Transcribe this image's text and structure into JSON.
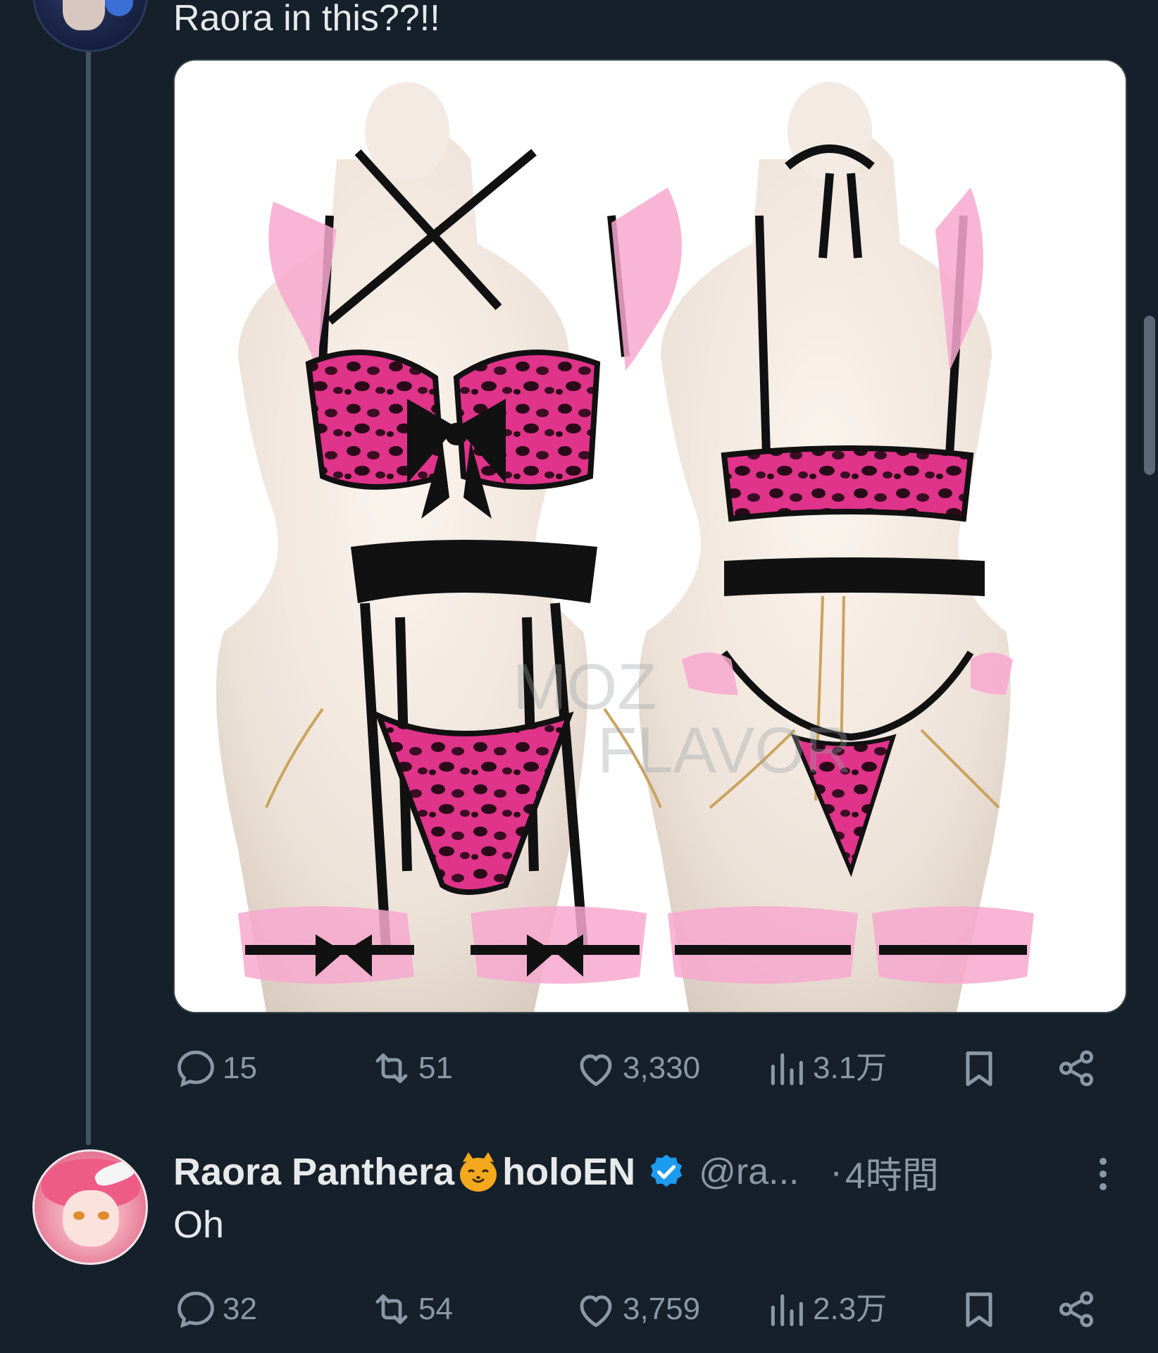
{
  "tweet1": {
    "text": "Raora in this??!!",
    "actions": {
      "replies": "15",
      "retweets": "51",
      "likes": "3,330",
      "views": "3.1万"
    }
  },
  "tweet2": {
    "display_name_part1": "Raora Panthera",
    "display_name_part2": "holoEN",
    "handle": "@ra...",
    "separator": "·",
    "time": "4時間",
    "text": "Oh",
    "actions": {
      "replies": "32",
      "retweets": "54",
      "likes": "3,759",
      "views": "2.3万"
    }
  },
  "media": {
    "watermark_line1": "MOZ",
    "watermark_line2": "FLAVOR"
  },
  "icons": {
    "reply": "reply-icon",
    "retweet": "retweet-icon",
    "like": "heart-icon",
    "views": "views-icon",
    "bookmark": "bookmark-icon",
    "share": "share-icon",
    "verified": "verified-badge-icon",
    "more": "more-icon",
    "emoji": "cat-face-emoji"
  },
  "colors": {
    "background": "#15202b",
    "text": "#e7e9ea",
    "secondary": "#8b98a5",
    "verified": "#1d9bf0",
    "thread_line": "#425364"
  }
}
